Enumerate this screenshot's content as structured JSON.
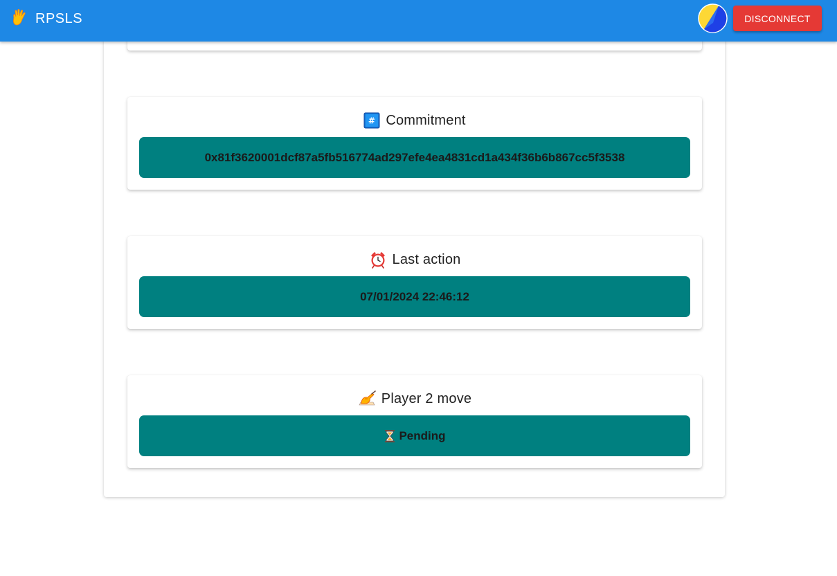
{
  "appbar": {
    "brand_name": "RPSLS",
    "disconnect_label": "DISCONNECT",
    "bar_color": "#1e88e5",
    "button_color": "#e53935"
  },
  "cards": [
    {
      "title": "Commitment",
      "icon": "hash-icon",
      "value": "0x81f3620001dcf87a5fb516774ad297efe4ea4831cd1a434f36b6b867cc5f3538"
    },
    {
      "title": "Last action",
      "icon": "alarm-clock-icon",
      "value": "07/01/2024 22:46:12"
    },
    {
      "title": "Player 2 move",
      "icon": "writing-hand-icon",
      "value": "Pending",
      "value_icon": "hourglass-icon"
    }
  ],
  "colors": {
    "value_box": "#008080"
  }
}
